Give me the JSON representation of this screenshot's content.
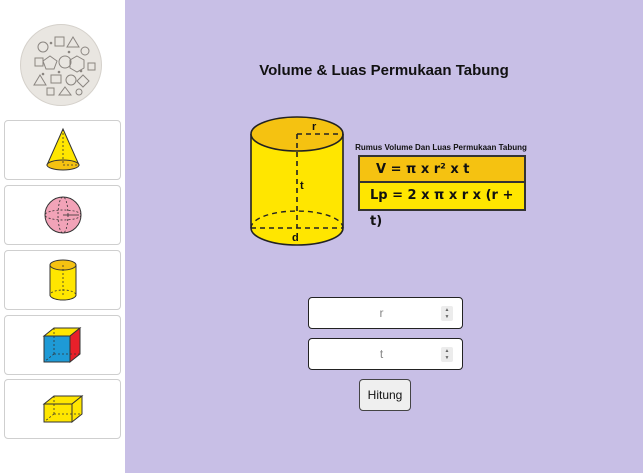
{
  "app": {
    "title": "Volume & Luas Permukaan Tabung"
  },
  "sidebar": {
    "items": [
      {
        "shape": "cone-icon"
      },
      {
        "shape": "sphere-icon"
      },
      {
        "shape": "cylinder-icon"
      },
      {
        "shape": "cube-icon"
      },
      {
        "shape": "cuboid-icon"
      }
    ]
  },
  "figure": {
    "label_r": "r",
    "label_t": "t",
    "label_d": "d"
  },
  "formula": {
    "caption": "Rumus Volume Dan Luas Permukaan Tabung",
    "volume": "V = π x r² x t",
    "surface": "Lp = 2 x π x r x (r + t)"
  },
  "form": {
    "r_placeholder": "r",
    "t_placeholder": "t",
    "button_label": "Hitung"
  },
  "colors": {
    "background": "#c8bfe6",
    "cylinder_fill": "#ffe600",
    "cylinder_top": "#f5c211"
  }
}
